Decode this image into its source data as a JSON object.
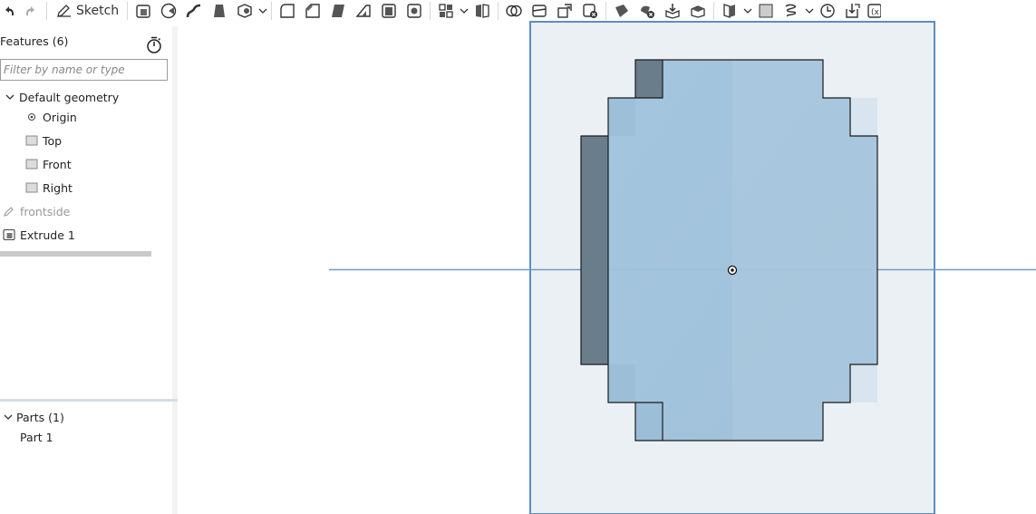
{
  "toolbar": {
    "sketch_label": "Sketch",
    "icons": [
      "undo-icon",
      "redo-icon",
      "sketch-pencil-icon",
      "extrude-icon",
      "revolve-icon",
      "sweep-icon",
      "loft-icon",
      "thicken-icon",
      "fillet-icon",
      "chamfer-icon",
      "draft-icon",
      "rib-icon",
      "shell-icon",
      "hole-icon",
      "pattern-icon",
      "mirror-icon",
      "boolean-icon",
      "split-icon",
      "transform-icon",
      "delete-part-icon",
      "modify-fillet-icon",
      "delete-face-icon",
      "move-face-icon",
      "replace-face-icon",
      "plane-icon",
      "surface-icon",
      "helix-icon",
      "mate-connector-icon",
      "import-icon",
      "variable-icon"
    ]
  },
  "features": {
    "title": "Features (6)",
    "filter_placeholder": "Filter by name or type",
    "default_geometry": "Default geometry",
    "items": [
      {
        "label": "Origin",
        "icon": "origin-icon"
      },
      {
        "label": "Top",
        "icon": "plane-icon"
      },
      {
        "label": "Front",
        "icon": "plane-icon"
      },
      {
        "label": "Right",
        "icon": "plane-icon"
      }
    ],
    "sketch": "frontside",
    "extrude": "Extrude 1"
  },
  "parts": {
    "title": "Parts (1)",
    "items": [
      "Part 1"
    ]
  },
  "colors": {
    "plane_fill": "#ebf0f5",
    "plane_edge": "#5c8ec4",
    "part_front": "#a6c6dd",
    "part_side": "#6a7d8b",
    "axis": "#6f9bc9"
  }
}
